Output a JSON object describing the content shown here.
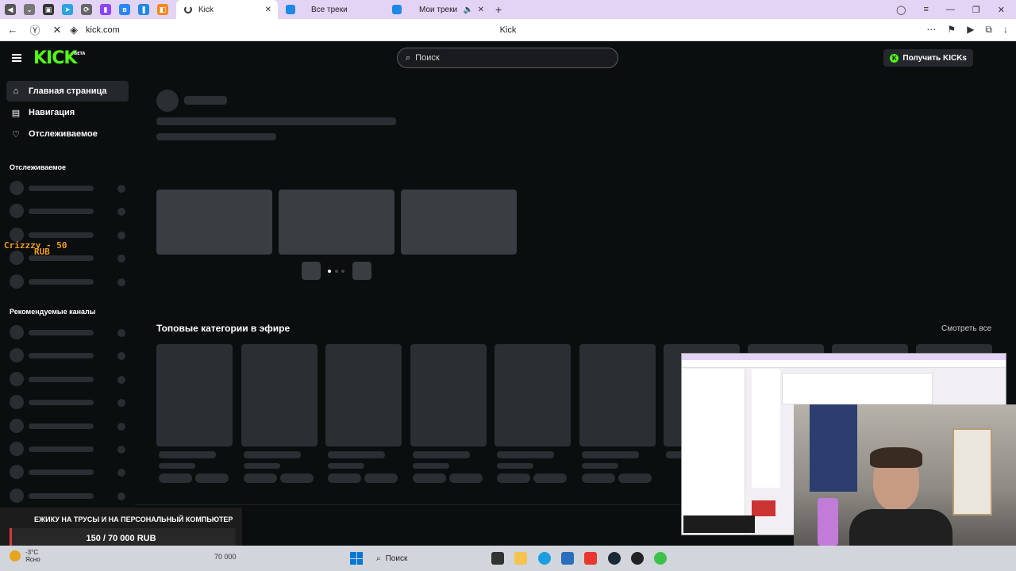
{
  "browser": {
    "tabs": [
      {
        "label": "Kick",
        "active": true
      },
      {
        "label": "Все треки",
        "active": false
      },
      {
        "label": "Мои треки",
        "active": false
      }
    ],
    "url": "kick.com",
    "page_title": "Kick"
  },
  "header": {
    "logo": "KICK",
    "logo_badge": "BETA",
    "search_placeholder": "Поиск",
    "get_kicks_label": "Получить KICKs"
  },
  "sidebar": {
    "nav": [
      {
        "label": "Главная страница",
        "icon": "home-icon",
        "active": true
      },
      {
        "label": "Навигация",
        "icon": "browse-icon",
        "active": false
      },
      {
        "label": "Отслеживаемое",
        "icon": "heart-icon",
        "active": false
      }
    ],
    "following_heading": "Отслеживаемое",
    "recommended_heading": "Рекомендуемые каналы"
  },
  "main": {
    "top_categories_heading": "Топовые категории в эфире",
    "see_all_label": "Смотреть все"
  },
  "overlay": {
    "donor_name": "Crizzzy - 50",
    "donor_currency": "RUB",
    "goal_title": "ЕЖИКУ НА ТРУСЫ И НА ПЕРСОНАЛЬНЫЙ КОМПЬЮТЕР",
    "goal_progress": "150 / 70 000 RUB",
    "goal_fraction": 0.0021
  },
  "taskbar": {
    "temperature": "-3°C",
    "weather": "Ясно",
    "goal_target": "70 000",
    "search_label": "Поиск"
  },
  "colors": {
    "brand_green": "#53fc18",
    "page_bg": "#0b0e0f",
    "skeleton": "#2b2e32",
    "tab_strip": "#e3d3f4"
  }
}
